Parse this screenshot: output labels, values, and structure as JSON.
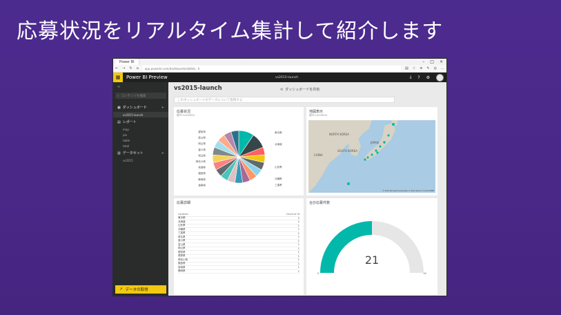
{
  "slide": {
    "title": "応募状況をリアルタイム集計して紹介します"
  },
  "browser": {
    "tab_label": "Power BI",
    "url": "app.powerbi.com/dashboards/ab6eb...0",
    "window_controls": [
      "–",
      "□",
      "×"
    ],
    "nav_icons": [
      "←",
      "→",
      "↻",
      "⌂"
    ],
    "toolbar_icons": [
      "▤",
      "☆",
      "≡",
      "✎",
      "◎",
      "…"
    ]
  },
  "header": {
    "app_name": "Power BI Preview",
    "center_text": "vs2015-launch",
    "icons": [
      "⤓",
      "?",
      "⚙"
    ]
  },
  "nav": {
    "collapse": "≡",
    "search_placeholder": "コンテンツを検索",
    "sections": [
      {
        "label": "ダッシュボード",
        "items": [
          "vs2015-launch"
        ]
      },
      {
        "label": "レポート",
        "items": [
          "map",
          "pie",
          "table",
          "total"
        ]
      },
      {
        "label": "データセット",
        "items": [
          "vs2015"
        ]
      }
    ],
    "get_data": "データの取得"
  },
  "main": {
    "dashboard_title": "vs2015-launch",
    "share_label": "ダッシュボードを共有",
    "qa_placeholder": "このダッシュボードのデータについて質問する"
  },
  "tiles": {
    "pie": {
      "title": "応募状況",
      "subtitle": "都市 Location"
    },
    "map": {
      "title": "地図表示",
      "subtitle": "都市 Location",
      "labels": [
        "NORTH KOREA",
        "SOUTH KOREA",
        "JAPAN",
        "CHINA"
      ],
      "credit": "© 2015 Microsoft Corporation  © 2015 Zenrin  © 2015 HERE"
    },
    "table": {
      "title": "応募詳細",
      "columns": [
        "Location",
        "Count of Id"
      ],
      "rows": [
        [
          "東京都",
          "2"
        ],
        [
          "北海道",
          "2"
        ],
        [
          "山形県",
          "1"
        ],
        [
          "沖縄県",
          "1"
        ],
        [
          "三重県",
          "1"
        ],
        [
          "埼玉県",
          "1"
        ],
        [
          "香川県",
          "1"
        ],
        [
          "富山県",
          "1"
        ],
        [
          "岡山県",
          "1"
        ],
        [
          "愛知県",
          "1"
        ],
        [
          "長野県",
          "1"
        ],
        [
          "神奈川県",
          "1"
        ],
        [
          "福島県",
          "1"
        ],
        [
          "宮城県",
          "1"
        ],
        [
          "静岡県",
          "1"
        ]
      ]
    },
    "gauge": {
      "title": "合計応募件数",
      "value": "21",
      "min": "0",
      "max": "42"
    }
  },
  "chart_data": {
    "type": "pie",
    "categories": [
      "東京都",
      "北海道",
      "山形県",
      "沖縄県",
      "三重県",
      "埼玉県",
      "香川県",
      "富山県",
      "岡山県",
      "愛知県",
      "長野県",
      "神奈川県",
      "福島県",
      "宮城県",
      "静岡県",
      "その他1",
      "その他2",
      "その他3",
      "その他4"
    ],
    "values": [
      2,
      2,
      1,
      1,
      1,
      1,
      1,
      1,
      1,
      1,
      1,
      1,
      1,
      1,
      1,
      1,
      1,
      1,
      1
    ],
    "visible_labels": [
      "東京都",
      "北海道",
      "山形県",
      "沖縄県",
      "三重県",
      "愛知県",
      "富山県",
      "岡山県",
      "香川県",
      "埼玉県",
      "神奈川県",
      "宮城県",
      "福島県",
      "静岡県",
      "長野県"
    ],
    "colors": [
      "#01b8aa",
      "#374649",
      "#fd625e",
      "#f2c80f",
      "#5f6b6d",
      "#8ad4eb",
      "#fe9666",
      "#a66999",
      "#3599b8",
      "#dfbfbf",
      "#4ac5bb",
      "#5f6b6d",
      "#fb8281",
      "#f4d25a",
      "#7f898a",
      "#a4ddee",
      "#fdab89",
      "#b687ac",
      "#28738a"
    ]
  }
}
